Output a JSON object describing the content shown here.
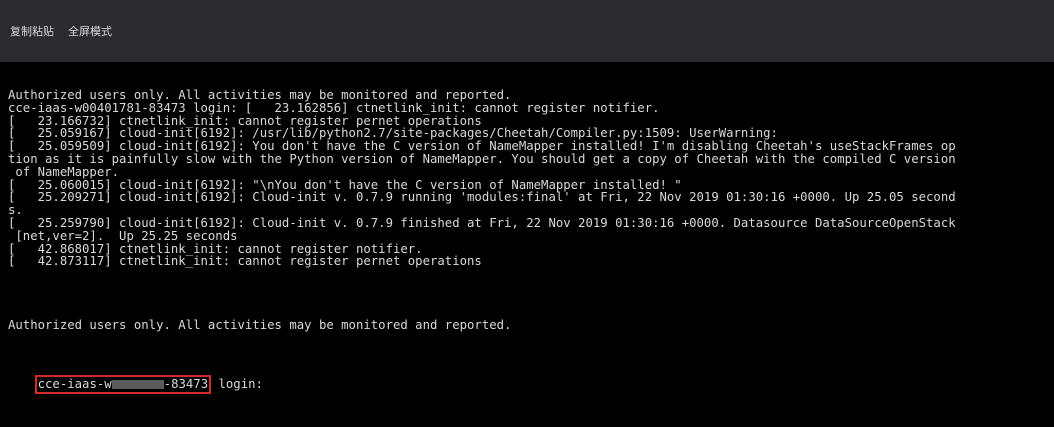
{
  "toolbar": {
    "copy_paste_label": "复制粘贴",
    "fullscreen_label": "全屏模式"
  },
  "console": {
    "lines": [
      "Authorized users only. All activities may be monitored and reported.",
      "cce-iaas-w00401781-83473 login: [   23.162856] ctnetlink_init: cannot register notifier.",
      "[   23.166732] ctnetlink_init: cannot register pernet operations",
      "[   25.059167] cloud-init[6192]: /usr/lib/python2.7/site-packages/Cheetah/Compiler.py:1509: UserWarning:",
      "[   25.059509] cloud-init[6192]: You don't have the C version of NameMapper installed! I'm disabling Cheetah's useStackFrames op",
      "tion as it is painfully slow with the Python version of NameMapper. You should get a copy of Cheetah with the compiled C version",
      " of NameMapper.",
      "[   25.060015] cloud-init[6192]: \"\\nYou don't have the C version of NameMapper installed! \"",
      "[   25.209271] cloud-init[6192]: Cloud-init v. 0.7.9 running 'modules:final' at Fri, 22 Nov 2019 01:30:16 +0000. Up 25.05 second",
      "s.",
      "[   25.259790] cloud-init[6192]: Cloud-init v. 0.7.9 finished at Fri, 22 Nov 2019 01:30:16 +0000. Datasource DataSourceOpenStack",
      " [net,ver=2].  Up 25.25 seconds",
      "[   42.868017] ctnetlink_init: cannot register notifier.",
      "[   42.873117] ctnetlink_init: cannot register pernet operations",
      "",
      "",
      "",
      "",
      "Authorized users only. All activities may be monitored and reported."
    ],
    "login": {
      "host_prefix": "cce-iaas-w",
      "host_suffix": "-83473",
      "prompt": " login:"
    }
  },
  "colors": {
    "toolbar_bg": "#2b2b2f",
    "console_bg": "#000000",
    "text": "#d9d9d9",
    "highlight_box": "#d32a2a"
  }
}
